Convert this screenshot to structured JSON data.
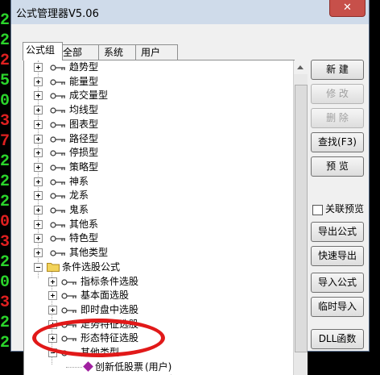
{
  "window": {
    "title": "公式管理器V5.06",
    "close_label": "✕"
  },
  "tabs": [
    "公式组",
    "全部",
    "系统",
    "用户"
  ],
  "tree": {
    "group_items": [
      "趋势型",
      "能量型",
      "成交量型",
      "均线型",
      "图表型",
      "路径型",
      "停损型",
      "策略型",
      "神系",
      "龙系",
      "鬼系",
      "其他系",
      "特色型",
      "其他类型"
    ],
    "folder": "条件选股公式",
    "sub_items": [
      "指标条件选股",
      "基本面选股",
      "即时盘中选股",
      "走势特征选股",
      "形态特征选股",
      "其他类型"
    ],
    "leaf": "创新低股票",
    "leaf_suffix": "(用户)",
    "leaf2_suffix": "(用户)"
  },
  "buttons": {
    "new": "新 建",
    "modify": "修 改",
    "delete": "删 除",
    "find": "查找(F3)",
    "preview": "预 览",
    "linked_preview": "关联预览",
    "export": "导出公式",
    "quick_export": "快速导出",
    "import": "导入公式",
    "temp_import": "临时导入",
    "dll": "DLL函数"
  },
  "background_digits": [
    "2",
    "2",
    "2",
    "5",
    "0",
    "3",
    "7",
    "2",
    "2",
    "2",
    "0",
    "3",
    "2",
    "0",
    "3",
    "2",
    "2"
  ],
  "colors": {
    "accent_red": "#e11919",
    "close_red": "#c7504a",
    "window_bg": "#ccd9ea"
  }
}
